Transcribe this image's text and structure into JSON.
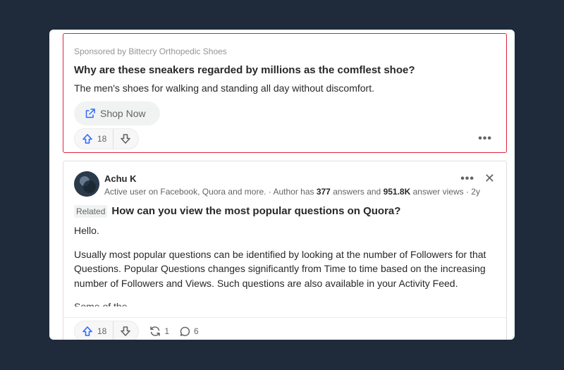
{
  "ad": {
    "sponsor_text": "Sponsored by Bittecry Orthopedic Shoes",
    "headline": "Why are these sneakers regarded by millions as the comflest shoe?",
    "description": "The men's shoes for walking and standing all day without discomfort.",
    "cta_label": "Shop Now",
    "cta_icon": "external-link-icon",
    "upvotes": "18",
    "more_label": "•••",
    "border_color": "#e0243a"
  },
  "answer": {
    "author_name": "Achu K",
    "cred_prefix": "Active user on Facebook, Quora and more. · Author has ",
    "answers_count": "377",
    "cred_mid": " answers and ",
    "views_count": "951.8K",
    "cred_suffix": " answer views · 2y",
    "more_label": "•••",
    "close_label": "✕",
    "related_tag": "Related",
    "related_question": "How can you view the most popular questions on Quora?",
    "paragraphs": [
      "Hello.",
      "Usually most popular questions can be identified by looking at the number of Followers for that Questions. Popular Questions changes significantly from Time to time based on the increasing number of Followers and Views. Such questions are also available in your Activity Feed."
    ],
    "truncated_text": "Some of the ...",
    "upvotes": "18",
    "shares": "1",
    "comments": "6"
  },
  "colors": {
    "accent_blue": "#2e69ff",
    "background": "#1f2b3a"
  }
}
